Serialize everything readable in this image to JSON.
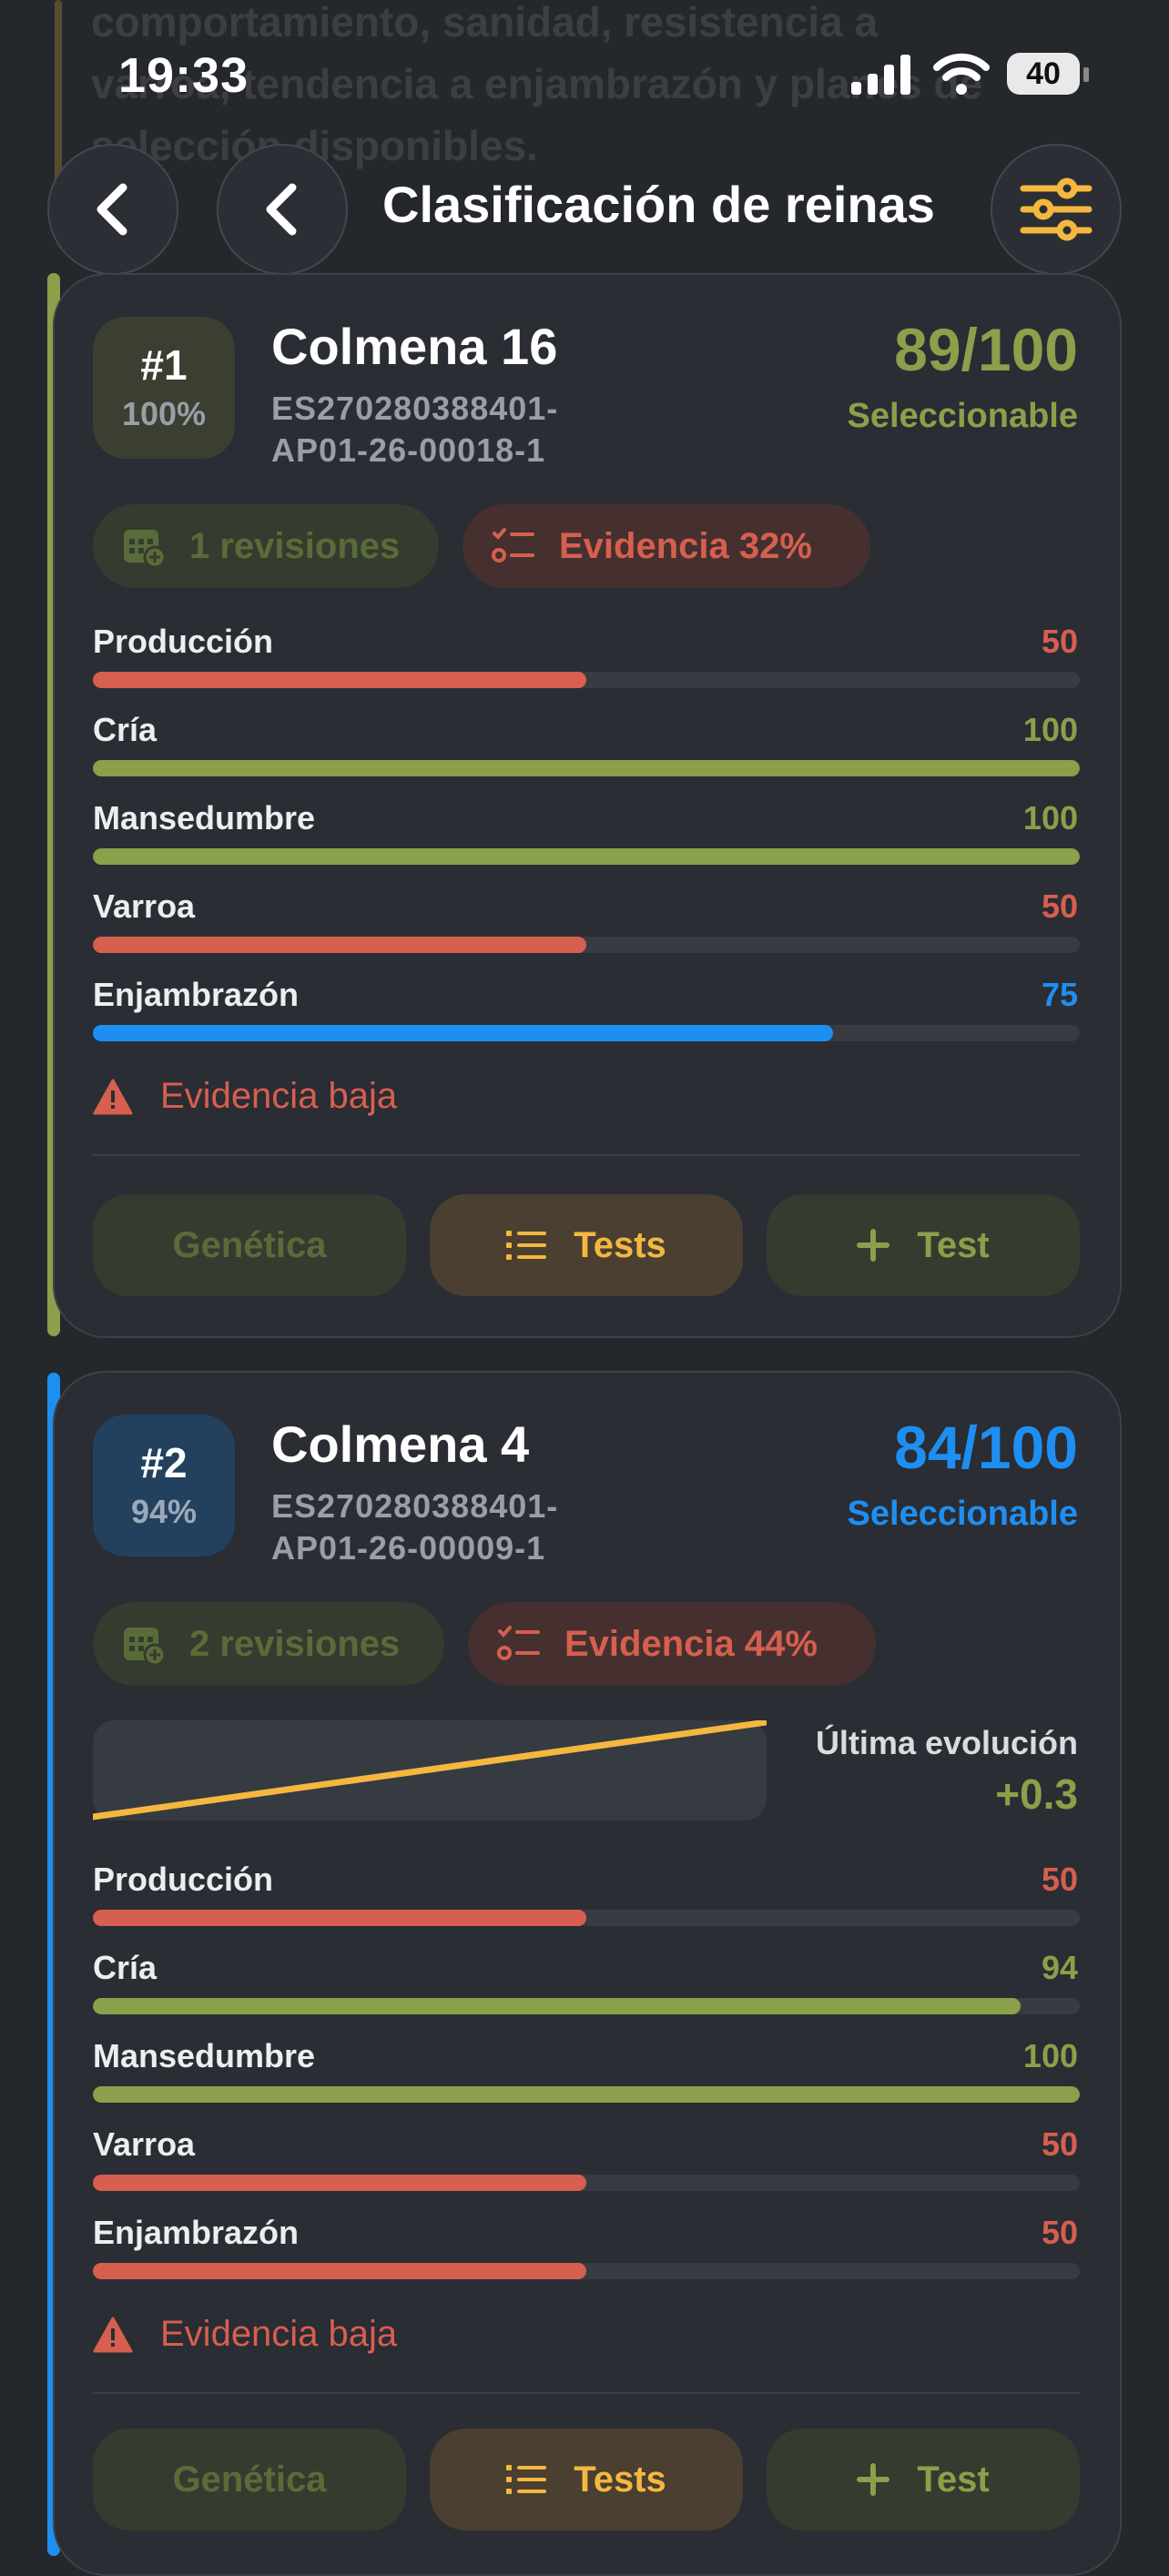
{
  "background_text": "comportamiento, sanidad, resistencia a varroa, tendencia a enjambrazón y planes de selección disponibles.",
  "status_bar": {
    "time": "19:33",
    "battery": "40"
  },
  "header": {
    "title": "Clasificación de reinas"
  },
  "colors": {
    "green": "#8aa04a",
    "red": "#d65f4f",
    "blue": "#1e8ff2",
    "yellow": "#f4b740"
  },
  "cards": [
    {
      "rank": "#1",
      "percent": "100%",
      "name": "Colmena 16",
      "code_line1": "ES270280388401-",
      "code_line2": "AP01-26-00018-1",
      "score": "89/100",
      "status": "Seleccionable",
      "accent": "green",
      "revisions": "1 revisiones",
      "evidence": "Evidencia 32%",
      "metrics": [
        {
          "label": "Producción",
          "value": "50",
          "pct": 50,
          "color": "red"
        },
        {
          "label": "Cría",
          "value": "100",
          "pct": 100,
          "color": "green"
        },
        {
          "label": "Mansedumbre",
          "value": "100",
          "pct": 100,
          "color": "green"
        },
        {
          "label": "Varroa",
          "value": "50",
          "pct": 50,
          "color": "red"
        },
        {
          "label": "Enjambrazón",
          "value": "75",
          "pct": 75,
          "color": "blue"
        }
      ],
      "warning": "Evidencia baja",
      "actions": {
        "genetics": "Genética",
        "tests": "Tests",
        "add_test": "Test"
      }
    },
    {
      "rank": "#2",
      "percent": "94%",
      "name": "Colmena 4",
      "code_line1": "ES270280388401-",
      "code_line2": "AP01-26-00009-1",
      "score": "84/100",
      "status": "Seleccionable",
      "accent": "blue",
      "revisions": "2 revisiones",
      "evidence": "Evidencia 44%",
      "evolution_label": "Última evolución",
      "evolution_value": "+0.3",
      "metrics": [
        {
          "label": "Producción",
          "value": "50",
          "pct": 50,
          "color": "red"
        },
        {
          "label": "Cría",
          "value": "94",
          "pct": 94,
          "color": "green"
        },
        {
          "label": "Mansedumbre",
          "value": "100",
          "pct": 100,
          "color": "green"
        },
        {
          "label": "Varroa",
          "value": "50",
          "pct": 50,
          "color": "red"
        },
        {
          "label": "Enjambrazón",
          "value": "50",
          "pct": 50,
          "color": "red"
        }
      ],
      "warning": "Evidencia baja",
      "actions": {
        "genetics": "Genética",
        "tests": "Tests",
        "add_test": "Test"
      }
    }
  ]
}
